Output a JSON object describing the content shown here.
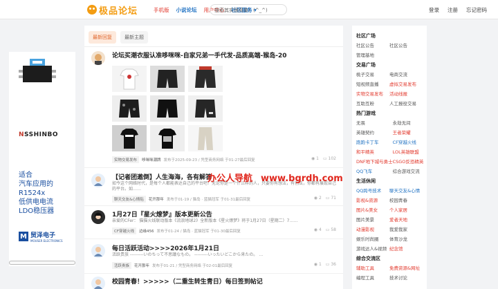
{
  "header": {
    "logo_text": "极品论坛",
    "nav": [
      "手机版",
      "小说论坛",
      "用户中心",
      "社区服务"
    ],
    "search_placeholder": "搜索其实很简单！(^_^)",
    "links": [
      "登录",
      "注册",
      "忘记密码"
    ]
  },
  "ad": {
    "brand_n": "N",
    "brand_rest": "SSHINBO",
    "lines": [
      "适合",
      "汽车应用的",
      "R1524x",
      "低供电电流",
      "LDO稳压器"
    ],
    "company": "贸泽电子",
    "company_en": "MOUSER ELECTRONICS"
  },
  "main": {
    "tabs": [
      "最新回复",
      "最新主题"
    ],
    "posts": [
      {
        "title": "论坛买潮衣服认准哆咪咪-自家兄弟一手代发-品质高端-猴岛-20",
        "tag": "实物交易发布",
        "user": "哆咪咪潮牌",
        "meta": "发布于2025-09-23 / 凭型商务网络 于01-27最后回复",
        "views": "1",
        "replies": "102"
      },
      {
        "title": "【记者团邀倒】人生海海，各有解答",
        "text": "如今这个网络时代，是每个人都能表达自己的平台吧！无论你是一个什么样的人，只要你有想法，有创法，你都有展现自己的平台。如……",
        "tag": "聊天交友&心情贴",
        "user": "花开那年",
        "meta": "发布于01-19 / 猫岛 · 蓝猫冠军 于01-31最后回复",
        "views": "2",
        "replies": "71"
      },
      {
        "title": "1月27日『星火燎梦』版本更新公告",
        "text": "亲爱的CFer：    猫猫火线联动版本《流浪地球2》全新版本《星火燎梦》将于1月27日（星期二）7……",
        "tag": "CF穿越火线",
        "user": "边缘456",
        "meta": "发布于01-24 / 猫岛 · 蓝猫冠军 于01-30最后回复",
        "views": "4",
        "replies": "58"
      },
      {
        "title": "每日活跃活动>>>>2026年1月21日",
        "text": "活跃贵族 ---------いのちって不思議なもの。     ---------いったいどこから来たの。 …",
        "tag": "活跃贵族",
        "user": "花开那年",
        "meta": "发布于01-21 / 凭型商务网络 于02-01最后回复",
        "views": "1",
        "replies": "36"
      },
      {
        "title": "校园青春！>>>>>（二重生转生青日）每日签到帖记",
        "text": "",
        "tag": "",
        "user": "",
        "meta": "",
        "views": "",
        "replies": ""
      }
    ]
  },
  "watermark": {
    "a": "办公人导航",
    "b": "www.bgrdh.com"
  },
  "sidebar": {
    "sections": [
      {
        "title": "社区广场",
        "items": [
          {
            "t": "社区公告",
            "c": ""
          },
          {
            "t": "社区公告",
            "c": ""
          },
          {
            "t": "管理基地",
            "c": ""
          }
        ]
      },
      {
        "title": "交易广场",
        "items": [
          {
            "t": "桃子交易",
            "c": ""
          },
          {
            "t": "电商交流",
            "c": ""
          },
          {
            "t": "短视频直播",
            "c": ""
          },
          {
            "t": "虚拟交易发布",
            "c": "r"
          },
          {
            "t": "实物交易发布",
            "c": "r"
          },
          {
            "t": "活动线报",
            "c": "r"
          },
          {
            "t": "互助互粉",
            "c": ""
          },
          {
            "t": "人工报役交易",
            "c": ""
          }
        ]
      },
      {
        "title": "热门游戏",
        "items": [
          {
            "t": "无畏",
            "c": ""
          },
          {
            "t": "永劫无间",
            "c": ""
          },
          {
            "t": "英雄契约",
            "c": ""
          },
          {
            "t": "王者荣耀",
            "c": "r"
          },
          {
            "t": "跑跑卡丁车",
            "c": "b"
          },
          {
            "t": "CF穿越火线",
            "c": "b"
          },
          {
            "t": "和平精英",
            "c": "r"
          },
          {
            "t": "LOL英雄联盟",
            "c": "r"
          },
          {
            "t": "DNF地下城与勇士",
            "c": "r"
          },
          {
            "t": "CSGO反恐精英",
            "c": "r"
          },
          {
            "t": "QQ飞车",
            "c": "b"
          },
          {
            "t": "综合游戏交流",
            "c": ""
          }
        ]
      },
      {
        "title": "生活休闲",
        "items": [
          {
            "t": "QQ跨号技术",
            "c": "b"
          },
          {
            "t": "聊天交友&心情",
            "c": "b"
          },
          {
            "t": "影视&资源",
            "c": "r"
          },
          {
            "t": "校园青春",
            "c": ""
          },
          {
            "t": "图片&美女",
            "c": "r"
          },
          {
            "t": "个人家居",
            "c": "r"
          },
          {
            "t": "图片美景",
            "c": ""
          },
          {
            "t": "爱者天地",
            "c": "r"
          },
          {
            "t": "动漫影视",
            "c": "r"
          },
          {
            "t": "我爱我家",
            "c": ""
          },
          {
            "t": "娱乐时尚圈",
            "c": ""
          },
          {
            "t": "体育沙龙",
            "c": ""
          },
          {
            "t": "游戏达人&视频",
            "c": ""
          },
          {
            "t": "纪念馆",
            "c": "r"
          }
        ]
      },
      {
        "title": "综合交流区",
        "items": [
          {
            "t": "辅助工具",
            "c": "r"
          },
          {
            "t": "免费资源&网址",
            "c": "r"
          },
          {
            "t": "编程工具",
            "c": ""
          },
          {
            "t": "技术讨论",
            "c": ""
          }
        ]
      }
    ]
  }
}
